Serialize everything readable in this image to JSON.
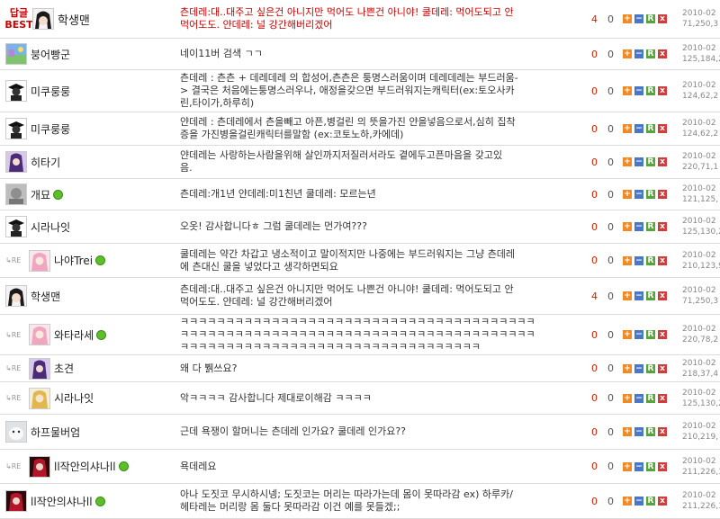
{
  "colors": {
    "best": "#cc0000",
    "online": "#5cbf2a",
    "plus": "#f08a24",
    "minus": "#4a78c8",
    "reply": "#5aa33c",
    "delete": "#d43b3b"
  },
  "labels": {
    "best_line1": "답글",
    "best_line2": "BEST",
    "re": "RE",
    "plus": "+",
    "minus": "−",
    "reply": "R",
    "delete": "x"
  },
  "rows": [
    {
      "best": true,
      "avatar": "anime-girl-icon",
      "name": "학생맨",
      "online": false,
      "comment": "츤데레:대..대주고 싶은건 아니지만 먹어도 나쁜건 아니야! 쿨데레: 먹어도되고 안\n먹어도도. 얀데레: 널 강간해버리겠어",
      "up": "4",
      "down": "0",
      "date": "2010-02",
      "ip": "71,250,3"
    },
    {
      "reply": false,
      "avatar": "scenery-icon",
      "name": "붕어빵군",
      "online": false,
      "comment": "네이11버 검색 ㄱㄱ",
      "up": "0",
      "down": "0",
      "date": "2010-02",
      "ip": "125,184,2"
    },
    {
      "reply": false,
      "avatar": "graduate-icon",
      "name": "미쿠룽룽",
      "online": false,
      "comment": "츤데레 : 츤츤 + 데레데레 의 합성어,츤츤은 퉁명스러움이며 데레데레는 부드러움-\n> 결국은 처음에는퉁명스러우나, 애정을갖으면 부드러워지는캐릭터(ex:토오사카\n린,타이가,하루히)",
      "up": "0",
      "down": "0",
      "date": "2010-02",
      "ip": "124,62,2"
    },
    {
      "reply": false,
      "avatar": "graduate-icon",
      "name": "미쿠룽룽",
      "online": false,
      "comment": "얀데레 : 츤데레에서 츤을빼고 아픈,병걸린 의 뜻을가진 얀을넣음으로서,심히 집착\n증을 가진병을걸린캐릭터를말함 (ex:코토노하,카에데)",
      "up": "0",
      "down": "0",
      "date": "2010-02",
      "ip": "124,62,2"
    },
    {
      "reply": false,
      "avatar": "purple-hair-icon",
      "name": "히타기",
      "online": false,
      "comment": "얀데레는 사랑하는사람을위해 살인까지저질러서라도 곁에두고픈마음을 갖고있\n음.",
      "up": "0",
      "down": "0",
      "date": "2010-02",
      "ip": "220,71,1"
    },
    {
      "reply": false,
      "avatar": "gray-photo-icon",
      "name": "개묘",
      "online": true,
      "comment": "츤데레:개1년 얀데레:미1친년 쿨데레: 모르는년",
      "up": "0",
      "down": "0",
      "date": "2010-02",
      "ip": "121,125,"
    },
    {
      "reply": false,
      "avatar": "graduate-icon",
      "name": "시라나잇",
      "online": false,
      "comment": "오옷! 감사합니다ㅎ 그럼 쿨데레는 먼가여???",
      "up": "0",
      "down": "0",
      "date": "2010-02",
      "ip": "125,130,2"
    },
    {
      "reply": true,
      "avatar": "pink-hair-icon",
      "name": "나야Trei",
      "online": true,
      "comment": "쿨데레는 약간 차갑고 냉소적이고 말이적지만 나중에는 부드러워지는 그냥 츤데레\n에 츤대신 쿨을 넣었다고 생각하면되요",
      "up": "0",
      "down": "0",
      "date": "2010-02",
      "ip": "210,123,9"
    },
    {
      "reply": false,
      "avatar": "anime-girl-icon",
      "name": "학생맨",
      "online": false,
      "comment": "츤데레:대..대주고 싶은건 아니지만 먹어도 나쁜건 아니야! 쿨데레: 먹어도되고 안\n먹어도도. 얀데레: 널 강간해버리겠어",
      "up": "4",
      "down": "0",
      "date": "2010-02",
      "ip": "71,250,3"
    },
    {
      "reply": true,
      "avatar": "pink-hair-icon",
      "name": "와타라세",
      "online": true,
      "comment": "ㅋㅋㅋㅋㅋㅋㅋㅋㅋㅋㅋㅋㅋㅋㅋㅋㅋㅋㅋㅋㅋㅋㅋㅋㅋㅋㅋㅋㅋㅋㅋㅋㅋㅋㅋㅋㅋㅋㅋ\nㅋㅋㅋㅋㅋㅋㅋㅋㅋㅋㅋㅋㅋㅋㅋㅋㅋㅋㅋㅋㅋㅋㅋㅋㅋㅋㅋㅋㅋㅋㅋㅋㅋㅋㅋㅋㅋㅋㅋ\nㅋㅋㅋㅋㅋㅋㅋㅋㅋㅋㅋㅋㅋㅋㅋㅋㅋㅋㅋㅋㅋㅋㅋㅋㅋㅋㅋㅋㅋㅋㅋㅋㅋ",
      "up": "0",
      "down": "0",
      "date": "2010-02",
      "ip": "220,78,2"
    },
    {
      "reply": true,
      "avatar": "purple-hair-icon",
      "name": "초견",
      "online": false,
      "comment": "왜 다 쀍쓰요?",
      "up": "0",
      "down": "0",
      "date": "2010-02",
      "ip": "218,37,4"
    },
    {
      "reply": true,
      "avatar": "blonde-hair-icon",
      "name": "시라나잇",
      "online": false,
      "comment": "악ㅋㅋㅋㅋ 감사합니다 제대로이해감 ㅋㅋㅋㅋ",
      "up": "0",
      "down": "0",
      "date": "2010-02",
      "ip": "125,130,2"
    },
    {
      "reply": false,
      "avatar": "white-seal-icon",
      "name": "하프물버엄",
      "online": false,
      "comment": "근데 욕쟁이 할머니는 츤데레 인가요? 쿨데레 인가요??",
      "up": "0",
      "down": "0",
      "date": "2010-02",
      "ip": "210,219,"
    },
    {
      "reply": true,
      "avatar": "dark-red-icon",
      "name": "ll작안의샤나ll",
      "online": true,
      "comment": "욕데레요",
      "up": "0",
      "down": "0",
      "date": "2010-02",
      "ip": "211,226,1"
    },
    {
      "reply": false,
      "avatar": "dark-red-icon",
      "name": "ll작안의샤나ll",
      "online": true,
      "comment": "아나 도짓코 무시하시넹; 도짓코는 머리는 따라가는데 몸이 못따라감 ex) 하루카/\n헤타레는 머리랑 몸 둘다 못따라감 이건 예를 못들겠;;",
      "up": "0",
      "down": "0",
      "date": "2010-02",
      "ip": "211,226,1"
    }
  ]
}
